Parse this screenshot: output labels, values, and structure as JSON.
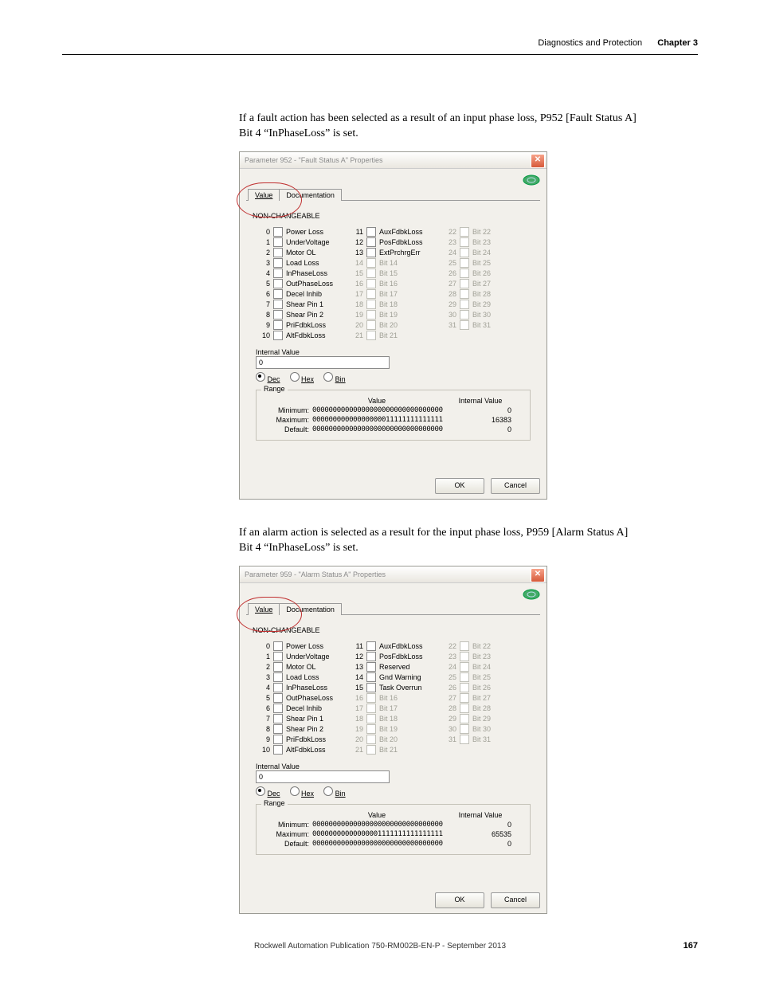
{
  "header": {
    "section": "Diagnostics and Protection",
    "chapter": "Chapter 3"
  },
  "paragraph1": "If a fault action has been selected as a result of an input phase loss, P952 [Fault Status A] Bit 4 “InPhaseLoss” is set.",
  "paragraph2": "If an alarm action is selected as a result for the input phase loss, P959 [Alarm Status A] Bit 4 “InPhaseLoss” is set.",
  "dialog1": {
    "title": "Parameter 952 - \"Fault Status A\" Properties",
    "tabs": {
      "value": "Value",
      "documentation": "Documentation"
    },
    "nonchangeable": "NON-CHANGEABLE",
    "bits": {
      "col0": [
        {
          "n": "0",
          "label": "Power Loss",
          "dim": false
        },
        {
          "n": "1",
          "label": "UnderVoltage",
          "dim": false
        },
        {
          "n": "2",
          "label": "Motor OL",
          "dim": false
        },
        {
          "n": "3",
          "label": "Load Loss",
          "dim": false
        },
        {
          "n": "4",
          "label": "InPhaseLoss",
          "dim": false
        },
        {
          "n": "5",
          "label": "OutPhaseLoss",
          "dim": false
        },
        {
          "n": "6",
          "label": "Decel Inhib",
          "dim": false
        },
        {
          "n": "7",
          "label": "Shear Pin 1",
          "dim": false
        },
        {
          "n": "8",
          "label": "Shear Pin 2",
          "dim": false
        },
        {
          "n": "9",
          "label": "PriFdbkLoss",
          "dim": false
        },
        {
          "n": "10",
          "label": "AltFdbkLoss",
          "dim": false
        }
      ],
      "col1": [
        {
          "n": "11",
          "label": "AuxFdbkLoss",
          "dim": false
        },
        {
          "n": "12",
          "label": "PosFdbkLoss",
          "dim": false
        },
        {
          "n": "13",
          "label": "ExtPrchrgErr",
          "dim": false
        },
        {
          "n": "14",
          "label": "Bit 14",
          "dim": true
        },
        {
          "n": "15",
          "label": "Bit 15",
          "dim": true
        },
        {
          "n": "16",
          "label": "Bit 16",
          "dim": true
        },
        {
          "n": "17",
          "label": "Bit 17",
          "dim": true
        },
        {
          "n": "18",
          "label": "Bit 18",
          "dim": true
        },
        {
          "n": "19",
          "label": "Bit 19",
          "dim": true
        },
        {
          "n": "20",
          "label": "Bit 20",
          "dim": true
        },
        {
          "n": "21",
          "label": "Bit 21",
          "dim": true
        }
      ],
      "col2": [
        {
          "n": "22",
          "label": "Bit 22",
          "dim": true
        },
        {
          "n": "23",
          "label": "Bit 23",
          "dim": true
        },
        {
          "n": "24",
          "label": "Bit 24",
          "dim": true
        },
        {
          "n": "25",
          "label": "Bit 25",
          "dim": true
        },
        {
          "n": "26",
          "label": "Bit 26",
          "dim": true
        },
        {
          "n": "27",
          "label": "Bit 27",
          "dim": true
        },
        {
          "n": "28",
          "label": "Bit 28",
          "dim": true
        },
        {
          "n": "29",
          "label": "Bit 29",
          "dim": true
        },
        {
          "n": "30",
          "label": "Bit 30",
          "dim": true
        },
        {
          "n": "31",
          "label": "Bit 31",
          "dim": true
        }
      ]
    },
    "internal": {
      "label": "Internal Value",
      "value": "0",
      "dec": "Dec",
      "hex": "Hex",
      "bin": "Bin"
    },
    "range": {
      "legend": "Range",
      "hvalue": "Value",
      "hiv": "Internal Value",
      "rows": [
        {
          "label": "Minimum:",
          "value": "00000000000000000000000000000000",
          "iv": "0"
        },
        {
          "label": "Maximum:",
          "value": "00000000000000000011111111111111",
          "iv": "16383"
        },
        {
          "label": "Default:",
          "value": "00000000000000000000000000000000",
          "iv": "0"
        }
      ]
    },
    "buttons": {
      "ok": "OK",
      "cancel": "Cancel"
    }
  },
  "dialog2": {
    "title": "Parameter 959 - \"Alarm Status A\" Properties",
    "tabs": {
      "value": "Value",
      "documentation": "Documentation"
    },
    "nonchangeable": "NON-CHANGEABLE",
    "bits": {
      "col0": [
        {
          "n": "0",
          "label": "Power Loss",
          "dim": false
        },
        {
          "n": "1",
          "label": "UnderVoltage",
          "dim": false
        },
        {
          "n": "2",
          "label": "Motor OL",
          "dim": false
        },
        {
          "n": "3",
          "label": "Load Loss",
          "dim": false
        },
        {
          "n": "4",
          "label": "InPhaseLoss",
          "dim": false
        },
        {
          "n": "5",
          "label": "OutPhaseLoss",
          "dim": false
        },
        {
          "n": "6",
          "label": "Decel Inhib",
          "dim": false
        },
        {
          "n": "7",
          "label": "Shear Pin 1",
          "dim": false
        },
        {
          "n": "8",
          "label": "Shear Pin 2",
          "dim": false
        },
        {
          "n": "9",
          "label": "PriFdbkLoss",
          "dim": false
        },
        {
          "n": "10",
          "label": "AltFdbkLoss",
          "dim": false
        }
      ],
      "col1": [
        {
          "n": "11",
          "label": "AuxFdbkLoss",
          "dim": false
        },
        {
          "n": "12",
          "label": "PosFdbkLoss",
          "dim": false
        },
        {
          "n": "13",
          "label": "Reserved",
          "dim": false
        },
        {
          "n": "14",
          "label": "Gnd Warning",
          "dim": false
        },
        {
          "n": "15",
          "label": "Task Overrun",
          "dim": false
        },
        {
          "n": "16",
          "label": "Bit 16",
          "dim": true
        },
        {
          "n": "17",
          "label": "Bit 17",
          "dim": true
        },
        {
          "n": "18",
          "label": "Bit 18",
          "dim": true
        },
        {
          "n": "19",
          "label": "Bit 19",
          "dim": true
        },
        {
          "n": "20",
          "label": "Bit 20",
          "dim": true
        },
        {
          "n": "21",
          "label": "Bit 21",
          "dim": true
        }
      ],
      "col2": [
        {
          "n": "22",
          "label": "Bit 22",
          "dim": true
        },
        {
          "n": "23",
          "label": "Bit 23",
          "dim": true
        },
        {
          "n": "24",
          "label": "Bit 24",
          "dim": true
        },
        {
          "n": "25",
          "label": "Bit 25",
          "dim": true
        },
        {
          "n": "26",
          "label": "Bit 26",
          "dim": true
        },
        {
          "n": "27",
          "label": "Bit 27",
          "dim": true
        },
        {
          "n": "28",
          "label": "Bit 28",
          "dim": true
        },
        {
          "n": "29",
          "label": "Bit 29",
          "dim": true
        },
        {
          "n": "30",
          "label": "Bit 30",
          "dim": true
        },
        {
          "n": "31",
          "label": "Bit 31",
          "dim": true
        }
      ]
    },
    "internal": {
      "label": "Internal Value",
      "value": "0",
      "dec": "Dec",
      "hex": "Hex",
      "bin": "Bin"
    },
    "range": {
      "legend": "Range",
      "hvalue": "Value",
      "hiv": "Internal Value",
      "rows": [
        {
          "label": "Minimum:",
          "value": "00000000000000000000000000000000",
          "iv": "0"
        },
        {
          "label": "Maximum:",
          "value": "00000000000000001111111111111111",
          "iv": "65535"
        },
        {
          "label": "Default:",
          "value": "00000000000000000000000000000000",
          "iv": "0"
        }
      ]
    },
    "buttons": {
      "ok": "OK",
      "cancel": "Cancel"
    }
  },
  "footer": {
    "publication": "Rockwell Automation Publication 750-RM002B-EN-P - September 2013",
    "page": "167"
  }
}
